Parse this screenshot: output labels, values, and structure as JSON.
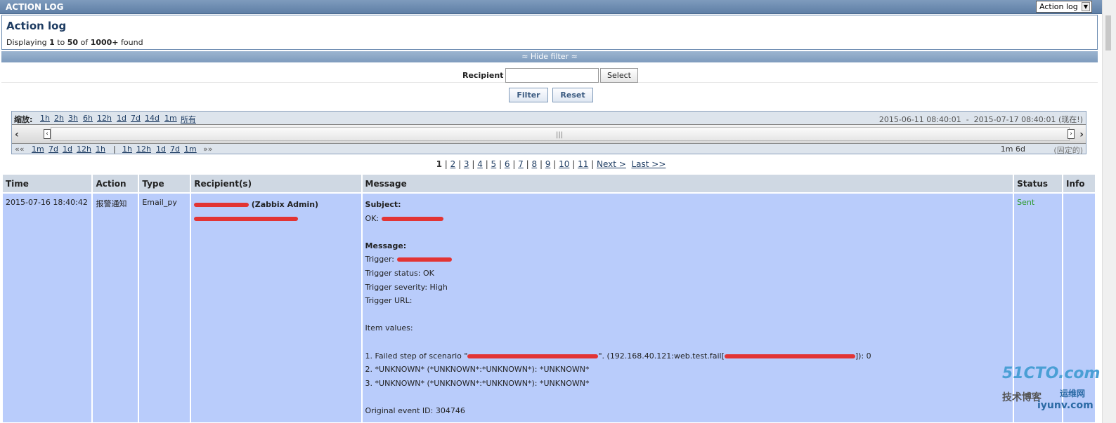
{
  "window": {
    "title": "ACTION LOG",
    "select_value": "Action log"
  },
  "header": {
    "title": "Action log",
    "displaying": "Displaying",
    "from": "1",
    "to_word": "to",
    "to": "50",
    "of_word": "of",
    "total": "1000+",
    "found": "found"
  },
  "filter": {
    "toggle_label": "≈ Hide filter ≈",
    "recipient_label": "Recipient",
    "recipient_value": "",
    "select_label": "Select",
    "filter_label": "Filter",
    "reset_label": "Reset"
  },
  "timeline": {
    "zoom_label": "缩放:",
    "zoom_links": [
      "1h",
      "2h",
      "3h",
      "6h",
      "12h",
      "1d",
      "7d",
      "14d",
      "1m",
      "所有"
    ],
    "range_start": "2015-06-11 08:40:01",
    "range_sep": "-",
    "range_end": "2015-07-17 08:40:01",
    "range_now": "(现在!)",
    "back_symbol": "««",
    "back_links": [
      "1m",
      "7d",
      "1d",
      "12h",
      "1h"
    ],
    "divider": "|",
    "fwd_links": [
      "1h",
      "12h",
      "1d",
      "7d",
      "1m"
    ],
    "fwd_symbol": "»»",
    "duration": "1m 6d",
    "fixed": "(固定的)"
  },
  "pager": {
    "current": "1",
    "pages": [
      "2",
      "3",
      "4",
      "5",
      "6",
      "7",
      "8",
      "9",
      "10",
      "11"
    ],
    "next": "Next >",
    "last": "Last >>"
  },
  "table": {
    "headers": [
      "Time",
      "Action",
      "Type",
      "Recipient(s)",
      "Message",
      "Status",
      "Info"
    ],
    "rows": [
      {
        "time": "2015-07-16 18:40:42",
        "action": "报警通知",
        "type": "Email_py",
        "recipient_name": "(Zabbix Admin)",
        "subject_label": "Subject:",
        "subject_text": "OK:",
        "message_label": "Message:",
        "trigger": "Trigger:",
        "trigger_status": "Trigger status: OK",
        "trigger_severity": "Trigger severity: High",
        "trigger_url": "Trigger URL:",
        "item_values": "Item values:",
        "item1_a": "1. Failed step of scenario \"",
        "item1_b": "\". (192.168.40.121:web.test.fail[",
        "item1_c": "]): 0",
        "item2": "2. *UNKNOWN* (*UNKNOWN*:*UNKNOWN*): *UNKNOWN*",
        "item3": "3. *UNKNOWN* (*UNKNOWN*:*UNKNOWN*): *UNKNOWN*",
        "original_event": "Original event ID: 304746",
        "status": "Sent",
        "info": ""
      }
    ]
  },
  "watermark": {
    "line1": "51CTO.com",
    "line2": "技术博客",
    "line3": "运维网",
    "line4": "iyunv.com"
  }
}
